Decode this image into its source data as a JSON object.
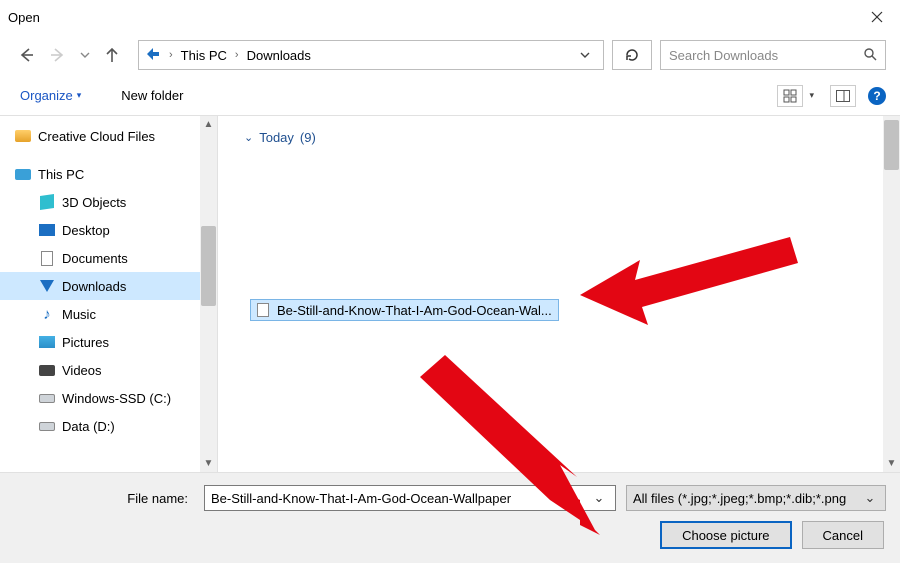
{
  "window": {
    "title": "Open"
  },
  "nav": {
    "crumbs": [
      "This PC",
      "Downloads"
    ]
  },
  "search": {
    "placeholder": "Search Downloads"
  },
  "toolbar": {
    "organize_label": "Organize",
    "newfolder_label": "New folder"
  },
  "tree": {
    "items": [
      {
        "label": "Creative Cloud Files",
        "icon": "cloud",
        "indent": 0
      },
      {
        "label": "This PC",
        "icon": "pc",
        "indent": 0
      },
      {
        "label": "3D Objects",
        "icon": "cube",
        "indent": 1
      },
      {
        "label": "Desktop",
        "icon": "desktop",
        "indent": 1
      },
      {
        "label": "Documents",
        "icon": "doc",
        "indent": 1
      },
      {
        "label": "Downloads",
        "icon": "down",
        "indent": 1,
        "selected": true
      },
      {
        "label": "Music",
        "icon": "music",
        "indent": 1
      },
      {
        "label": "Pictures",
        "icon": "pic",
        "indent": 1
      },
      {
        "label": "Videos",
        "icon": "video",
        "indent": 1
      },
      {
        "label": "Windows-SSD (C:)",
        "icon": "drive",
        "indent": 1
      },
      {
        "label": "Data (D:)",
        "icon": "drive",
        "indent": 1
      }
    ]
  },
  "content": {
    "group_label": "Today",
    "group_count": "(9)",
    "selected_file_display": "Be-Still-and-Know-That-I-Am-God-Ocean-Wal..."
  },
  "footer": {
    "file_name_label": "File name:",
    "file_name_value": "Be-Still-and-Know-That-I-Am-God-Ocean-Wallpaper",
    "filter_value": "All files (*.jpg;*.jpeg;*.bmp;*.dib;*.png",
    "primary_button": "Choose picture",
    "cancel_button": "Cancel"
  }
}
